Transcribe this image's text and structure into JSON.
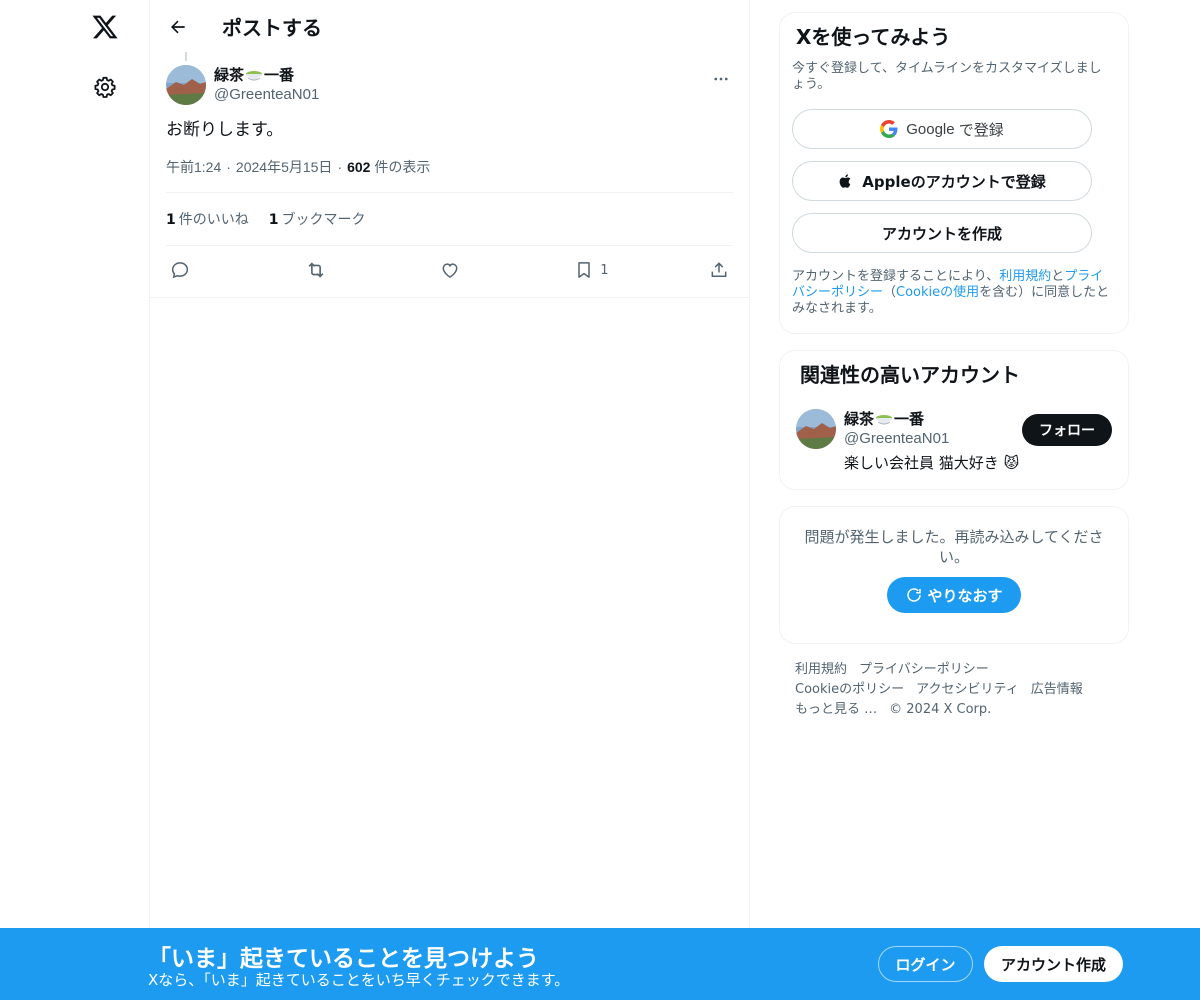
{
  "nav": {
    "logo_icon": "x-logo-icon",
    "settings_icon": "gear-icon"
  },
  "header": {
    "title": "ポストする"
  },
  "post": {
    "author_name_prefix": "緑茶",
    "author_name_suffix": "一番",
    "author_emoji": "matcha-tea-emoji",
    "author_handle": "@GreenteaN01",
    "text": "お断りします。",
    "time": "午前1:24",
    "date": "2024年5月15日",
    "views_count": "602",
    "views_label": "件の表示",
    "separator": "·",
    "likes_count": "1",
    "likes_label": "件のいいね",
    "bookmarks_count": "1",
    "bookmarks_label": "ブックマーク",
    "action_bookmark_count": "1"
  },
  "signup": {
    "title": "Xを使ってみよう",
    "description": "今すぐ登録して、タイムラインをカスタマイズしましょう。",
    "google_label_brand": "Google",
    "google_label_rest": "で登録",
    "apple_label": "Appleのアカウントで登録",
    "create_label": "アカウントを作成",
    "legal_1": "アカウントを登録することにより、",
    "legal_terms": "利用規約",
    "legal_and": "と",
    "legal_privacy": "プライバシーポリシー",
    "legal_2": "（",
    "legal_cookie": "Cookieの使用",
    "legal_3": "を含む）に同意したとみなされます。"
  },
  "related": {
    "title": "関連性の高いアカウント",
    "name_prefix": "緑茶",
    "name_suffix": "一番",
    "handle": "@GreenteaN01",
    "bio": "楽しい会社員 猫大好き",
    "follow_label": "フォロー"
  },
  "error": {
    "message": "問題が発生しました。再読み込みしてください。",
    "retry_label": "やりなおす"
  },
  "footer": {
    "links": [
      "利用規約",
      "プライバシーポリシー",
      "Cookieのポリシー",
      "アクセシビリティ",
      "広告情報",
      "もっと見る …"
    ],
    "copyright": "© 2024 X Corp."
  },
  "bottom_bar": {
    "title": "「いま」起きていることを見つけよう",
    "subtitle": "Xなら、「いま」起きていることをいち早くチェックできます。",
    "login_label": "ログイン",
    "signup_label": "アカウント作成"
  },
  "colors": {
    "accent": "#1d9bf0",
    "text": "#0f1419",
    "muted": "#536471",
    "border": "#eff3f4"
  }
}
